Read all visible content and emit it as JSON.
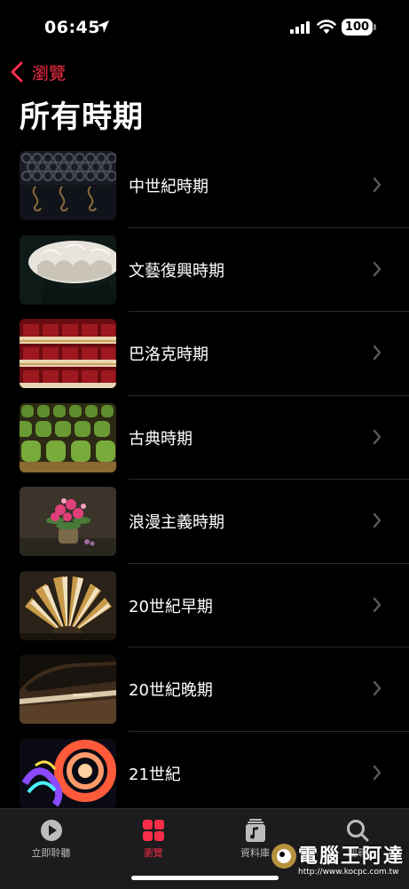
{
  "status_bar": {
    "time": "06:45",
    "battery": "100"
  },
  "nav": {
    "back_label": "瀏覽"
  },
  "page": {
    "title": "所有時期"
  },
  "list": [
    {
      "label": "中世紀時期",
      "thumb": "chainmail-armor"
    },
    {
      "label": "文藝復興時期",
      "thumb": "lace-ruff-collar"
    },
    {
      "label": "巴洛克時期",
      "thumb": "opera-house-balconies"
    },
    {
      "label": "古典時期",
      "thumb": "green-theater-seats"
    },
    {
      "label": "浪漫主義時期",
      "thumb": "flower-bouquet-still-life"
    },
    {
      "label": "20世紀早期",
      "thumb": "art-deco-fan"
    },
    {
      "label": "20世紀晚期",
      "thumb": "vintage-car"
    },
    {
      "label": "21世紀",
      "thumb": "neon-light-swirl"
    }
  ],
  "tabbar": {
    "listen_now": "立即聆聽",
    "browse": "瀏覽",
    "library": "資料庫",
    "search": "搜尋"
  },
  "watermark": {
    "text": "電腦王阿達",
    "url": "http://www.kocpc.com.tw"
  },
  "colors": {
    "accent": "#fa2d48",
    "background": "#000000",
    "tabbar": "#1c1c1e"
  }
}
